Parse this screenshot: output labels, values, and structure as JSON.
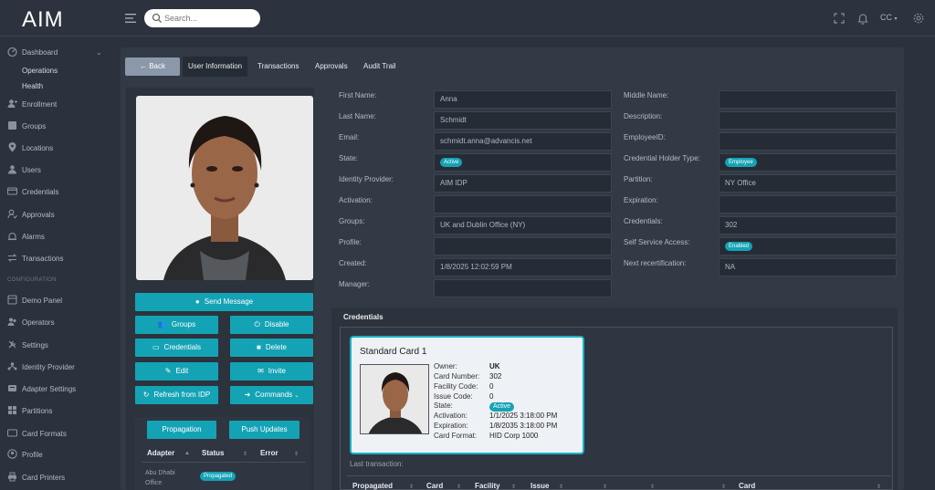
{
  "app": {
    "logo_text": "AIM"
  },
  "search": {
    "placeholder": "Search..."
  },
  "header": {
    "user": "CC"
  },
  "colors": {
    "accent": "#14a3b5",
    "card_border": "#17b3c5"
  },
  "sidebar": {
    "items": [
      {
        "label": "Dashboard",
        "icon": "dashboard-icon"
      },
      {
        "label": "Operations",
        "icon": ""
      },
      {
        "label": "Health",
        "icon": ""
      },
      {
        "label": "Enrollment",
        "icon": "enrollment-icon"
      },
      {
        "label": "Groups",
        "icon": "groups-icon"
      },
      {
        "label": "Locations",
        "icon": "location-icon"
      },
      {
        "label": "Users",
        "icon": "users-icon"
      },
      {
        "label": "Credentials",
        "icon": "credentials-icon"
      },
      {
        "label": "Approvals",
        "icon": "approvals-icon"
      },
      {
        "label": "Alarms",
        "icon": "alarms-icon"
      },
      {
        "label": "Transactions",
        "icon": "transactions-icon"
      }
    ],
    "section": "CONFIGURATION",
    "config_items": [
      {
        "label": "Demo Panel"
      },
      {
        "label": "Operators"
      },
      {
        "label": "Settings"
      },
      {
        "label": "Identity Provider"
      },
      {
        "label": "Adapter Settings"
      },
      {
        "label": "Partitions"
      },
      {
        "label": "Card Formats"
      },
      {
        "label": "Profile"
      },
      {
        "label": "Card Printers"
      }
    ]
  },
  "tabs": {
    "back": "Back",
    "items": [
      "User Information",
      "Transactions",
      "Approvals",
      "Audit Trail"
    ]
  },
  "actions": {
    "send_message": "Send Message",
    "groups": "Groups",
    "disable": "Disable",
    "credentials": "Credentials",
    "delete": "Delete",
    "edit": "Edit",
    "invite": "Invite",
    "refresh": "Refresh from IDP",
    "commands": "Commands"
  },
  "adapter": {
    "propagation": "Propagation",
    "push_updates": "Push Updates",
    "columns": [
      "Adapter",
      "Status",
      "Error"
    ],
    "rows": [
      {
        "adapter": "Abu Dhabi Office",
        "status": "Propagated",
        "error": ""
      }
    ]
  },
  "user": {
    "left": [
      {
        "label": "First Name:",
        "value": "Anna"
      },
      {
        "label": "Last Name:",
        "value": "Schmidt"
      },
      {
        "label": "Email:",
        "value": "schmidt.anna@advancis.net"
      },
      {
        "label": "State:",
        "value": "Active",
        "badge": true
      },
      {
        "label": "Identity Provider:",
        "value": "AIM IDP"
      },
      {
        "label": "Activation:",
        "value": ""
      },
      {
        "label": "Groups:",
        "value": "UK and Dublin Office (NY)"
      },
      {
        "label": "Profile:",
        "value": ""
      },
      {
        "label": "Created:",
        "value": "1/8/2025 12:02:59 PM"
      },
      {
        "label": "Manager:",
        "value": ""
      }
    ],
    "right": [
      {
        "label": "Middle Name:",
        "value": ""
      },
      {
        "label": "Description:",
        "value": ""
      },
      {
        "label": "EmployeeID:",
        "value": ""
      },
      {
        "label": "Credential Holder Type:",
        "value": "Employee",
        "badge": true
      },
      {
        "label": "Partition:",
        "value": "NY Office"
      },
      {
        "label": "Expiration:",
        "value": ""
      },
      {
        "label": "Credentials:",
        "value": "302"
      },
      {
        "label": "Self Service Access:",
        "value": "Enabled",
        "badge": true
      },
      {
        "label": "Next recertification:",
        "value": "NA"
      }
    ]
  },
  "credentials": {
    "title": "Credentials",
    "card": {
      "name": "Standard Card 1",
      "fields": [
        {
          "label": "Owner:",
          "value": "UK"
        },
        {
          "label": "Card Number:",
          "value": "302"
        },
        {
          "label": "Facility Code:",
          "value": "0"
        },
        {
          "label": "Issue Code:",
          "value": "0"
        },
        {
          "label": "State:",
          "value": "Active"
        },
        {
          "label": "Activation:",
          "value": "1/1/2025 3:18:00 PM"
        },
        {
          "label": "Expiration:",
          "value": "1/8/2035 3:18:00 PM"
        },
        {
          "label": "Card Format:",
          "value": "HID Corp 1000"
        }
      ]
    },
    "last_transaction": "Last transaction:",
    "tx_columns": [
      "Propagated",
      "Card",
      "Facility",
      "Issue",
      "Card"
    ]
  }
}
